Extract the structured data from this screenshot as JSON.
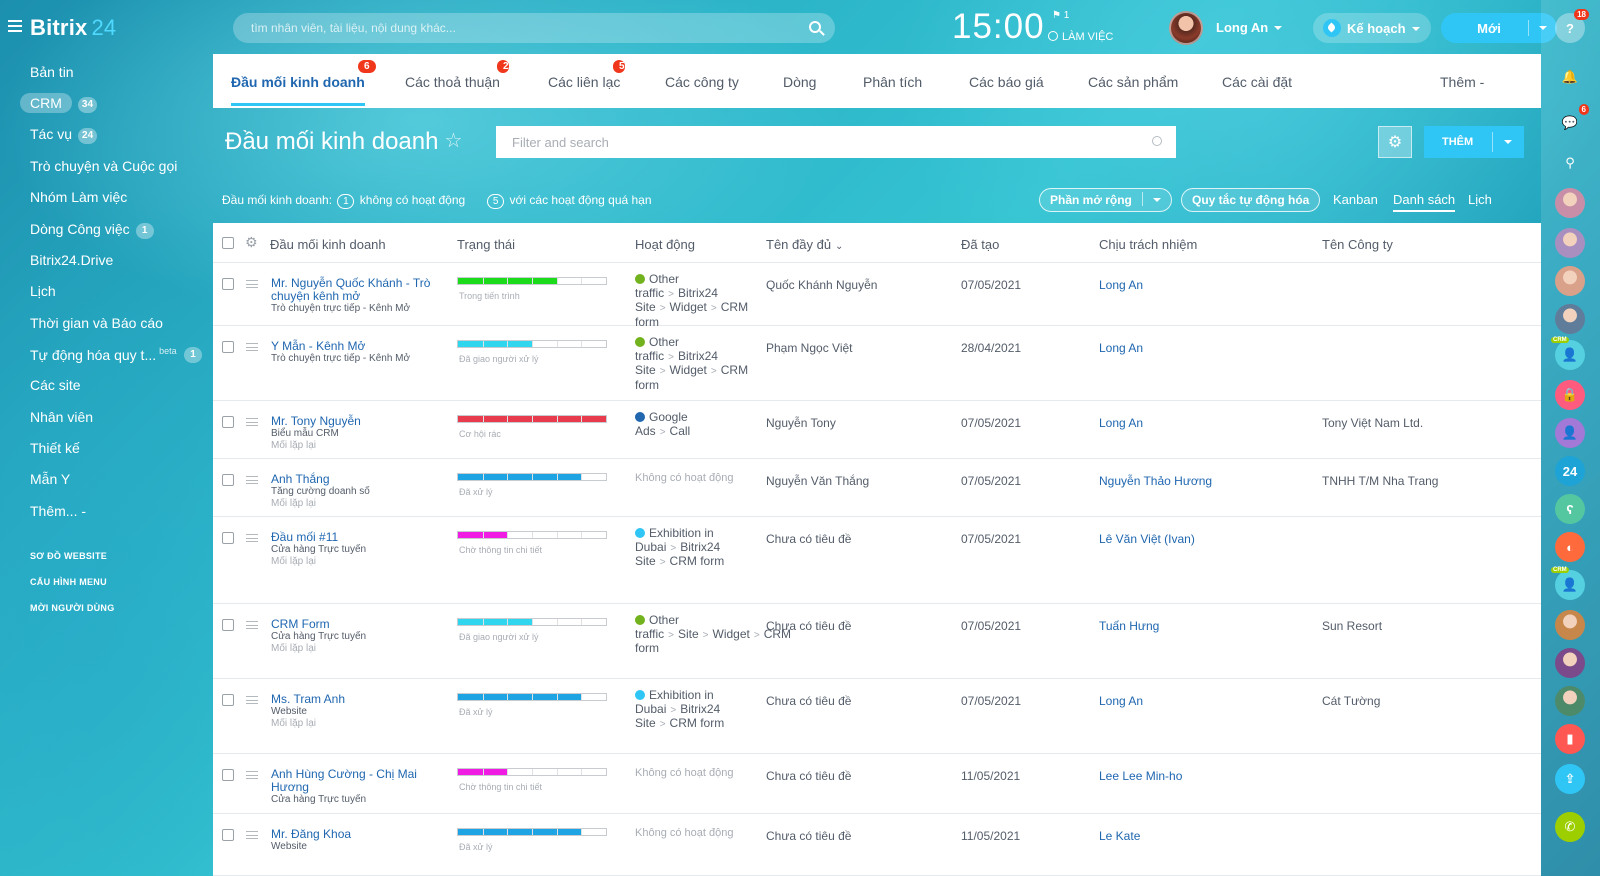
{
  "app": {
    "logo_part1": "Bitrix",
    "logo_part2": "24"
  },
  "header": {
    "search_placeholder": "tìm nhân viên, tài liệu, nội dung khác...",
    "clock": "15:00",
    "flag_count": "1",
    "work_status": "LÀM VIỆC",
    "user_name": "Long An",
    "plan_label": "Kế hoạch",
    "new_label": "Mới"
  },
  "sidebar": {
    "items": [
      {
        "label": "Bản tin"
      },
      {
        "label": "CRM",
        "badge": "34"
      },
      {
        "label": "Tác vụ",
        "badge": "24"
      },
      {
        "label": "Trò chuyện và Cuộc gọi"
      },
      {
        "label": "Nhóm Làm việc"
      },
      {
        "label": "Dòng Công việc",
        "badge": "1"
      },
      {
        "label": "Bitrix24.Drive"
      },
      {
        "label": "Lịch"
      },
      {
        "label": "Thời gian và Báo cáo"
      },
      {
        "label": "Tự động hóa quy t...",
        "beta": "beta",
        "badge": "1"
      },
      {
        "label": "Các site"
      },
      {
        "label": "Nhân viên"
      },
      {
        "label": "Thiết kế"
      },
      {
        "label": "Mẫn Y"
      },
      {
        "label": "Thêm... -"
      }
    ],
    "footer": [
      "SƠ ĐỒ WEBSITE",
      "CẤU HÌNH MENU",
      "MỜI NGƯỜI DÙNG"
    ]
  },
  "right_bar": {
    "help_badge": "18",
    "chat_badge": "6",
    "bitrix_icon_text": "24",
    "crm_tag": "CRM",
    "colors": [
      "#ffffff",
      "#ffffff",
      "#ffffff",
      "#ffffff",
      "#c88ea8",
      "#a88fbf",
      "#d9a08a",
      "#5f7d9a",
      "#55d0e0",
      "#ff5b7f",
      "#a279d6",
      "#1ea3d6",
      "#54c7a0",
      "#ff6a3d",
      "#55d0e0",
      "#c8874a",
      "#7a4a8a",
      "#4d8a6a",
      "#ff5752",
      "#2fc6f6",
      "#9dcf00"
    ]
  },
  "tabs": [
    {
      "label": "Đầu mối kinh doanh",
      "badge": "6",
      "active": true
    },
    {
      "label": "Các thoả thuận",
      "badge": "23"
    },
    {
      "label": "Các liên lạc",
      "badge": "5"
    },
    {
      "label": "Các công ty"
    },
    {
      "label": "Dòng"
    },
    {
      "label": "Phân tích"
    },
    {
      "label": "Các báo giá"
    },
    {
      "label": "Các sản phẩm"
    },
    {
      "label": "Các cài đặt"
    },
    {
      "label": "Thêm -"
    }
  ],
  "page": {
    "title": "Đầu mối kinh doanh",
    "filter_placeholder": "Filter and search",
    "add_label": "THÊM",
    "counts_label": "Đầu mối kinh doanh:",
    "no_activity_count": "1",
    "no_activity_label": "không có hoạt động",
    "overdue_count": "5",
    "overdue_label": "với các hoạt động quá hạn",
    "extensions_label": "Phần mở rộng",
    "automation_label": "Quy tắc tự động hóa",
    "views": [
      "Kanban",
      "Danh sách",
      "Lịch"
    ]
  },
  "table": {
    "columns": [
      "Đầu mối kinh doanh",
      "Trạng thái",
      "Hoạt động",
      "Tên đầy đủ",
      "Đã tạo",
      "Chịu trách nhiệm",
      "Tên Công ty"
    ],
    "rows": [
      {
        "name": "Mr. Nguyễn Quốc Khánh - Trò chuyện kênh mở",
        "sub1": "Trò chuyện trực tiếp - Kênh Mở",
        "sub2": "",
        "stage": "Trong tiến trình",
        "stage_fill": 0.67,
        "stage_color": "#1bdb1b",
        "activity": [
          "Other traffic",
          "Bitrix24 Site",
          "Widget",
          "CRM form"
        ],
        "activity_dot": "#73b21f",
        "fullname": "Quốc Khánh Nguyễn",
        "created": "07/05/2021",
        "responsible": "Long An",
        "company": ""
      },
      {
        "name": "Y Mẫn - Kênh Mở",
        "sub1": "Trò chuyện trực tiếp - Kênh Mở",
        "sub2": "",
        "stage": "Đã giao người xử lý",
        "stage_fill": 0.5,
        "stage_color": "#2fd6ee",
        "activity": [
          "Other traffic",
          "Bitrix24 Site",
          "Widget",
          "CRM form"
        ],
        "activity_dot": "#73b21f",
        "fullname": "Phạm Ngọc Việt",
        "created": "28/04/2021",
        "responsible": "Long An",
        "company": ""
      },
      {
        "name": "Mr. Tony Nguyễn",
        "sub1": "Biểu mẫu CRM",
        "sub2": "Mối lặp lại",
        "stage": "Cơ hội rác",
        "stage_fill": 1.0,
        "stage_color": "#e83b4e",
        "activity": [
          "Google Ads",
          "Call"
        ],
        "activity_dot": "#2067b0",
        "fullname": "Nguyễn Tony",
        "created": "07/05/2021",
        "responsible": "Long An",
        "company": "Tony Việt Nam Ltd."
      },
      {
        "name": "Anh Thắng",
        "sub1": "Tăng cường doanh số",
        "sub2": "Mối lặp lại",
        "stage": "Đã xử lý",
        "stage_fill": 0.83,
        "stage_color": "#1ea3e3",
        "activity_none": "Không có hoạt động",
        "fullname": "Nguyễn Văn Thắng",
        "created": "07/05/2021",
        "responsible": "Nguyễn Thảo Hương",
        "company": "TNHH T/M Nha Trang"
      },
      {
        "name": "Đầu mối #11",
        "sub1": "Cửa hàng Trực tuyến",
        "sub2": "Mối lặp lại",
        "stage": "Chờ thông tin chi tiết",
        "stage_fill": 0.33,
        "stage_color": "#f01ce3",
        "activity": [
          "Exhibition in Dubai",
          "Bitrix24 Site",
          "CRM form"
        ],
        "activity_dot": "#2fc6f6",
        "fullname": "Chưa có tiêu đề",
        "created": "07/05/2021",
        "responsible": "Lê Văn Việt (Ivan)",
        "company": ""
      },
      {
        "name": "CRM Form",
        "sub1": "Cửa hàng Trực tuyến",
        "sub2": "Mối lặp lại",
        "stage": "Đã giao người xử lý",
        "stage_fill": 0.5,
        "stage_color": "#2fd6ee",
        "activity": [
          "Other traffic",
          "Site",
          "Widget",
          "CRM form"
        ],
        "activity_dot": "#73b21f",
        "fullname": "Chưa có tiêu đề",
        "created": "07/05/2021",
        "responsible": "Tuấn Hưng",
        "company": "Sun Resort"
      },
      {
        "name": "Ms. Tram Anh",
        "sub1": "Website",
        "sub2": "Mối lặp lại",
        "stage": "Đã xử lý",
        "stage_fill": 0.83,
        "stage_color": "#1ea3e3",
        "activity": [
          "Exhibition in Dubai",
          "Bitrix24 Site",
          "CRM form"
        ],
        "activity_dot": "#2fc6f6",
        "fullname": "Chưa có tiêu đề",
        "created": "07/05/2021",
        "responsible": "Long An",
        "company": "Cát Tường"
      },
      {
        "name": "Anh Hùng Cường - Chị Mai Hương",
        "sub1": "Cửa hàng Trực tuyến",
        "sub2": "",
        "stage": "Chờ thông tin chi tiết",
        "stage_fill": 0.33,
        "stage_color": "#f01ce3",
        "activity_none": "Không có hoạt động",
        "fullname": "Chưa có tiêu đề",
        "created": "11/05/2021",
        "responsible": "Lee Lee Min-ho",
        "company": ""
      },
      {
        "name": "Mr. Đăng Khoa",
        "sub1": "Website",
        "sub2": "",
        "stage": "Đã xử lý",
        "stage_fill": 0.83,
        "stage_color": "#1ea3e3",
        "activity_none": "Không có hoạt động",
        "fullname": "Chưa có tiêu đề",
        "created": "11/05/2021",
        "responsible": "Le Kate",
        "company": ""
      }
    ]
  }
}
